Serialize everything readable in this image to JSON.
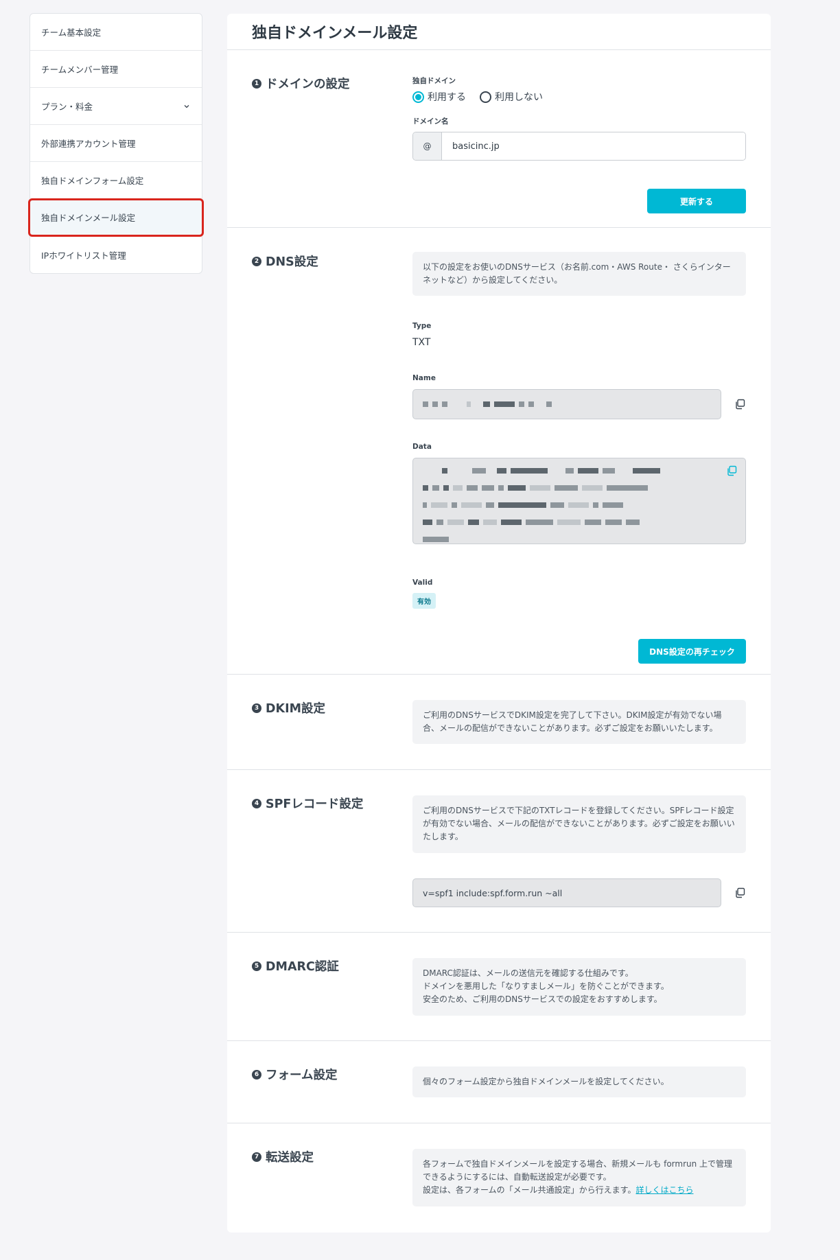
{
  "sidebar": {
    "items": [
      {
        "label": "チーム基本設定"
      },
      {
        "label": "チームメンバー管理"
      },
      {
        "label": "プラン・料金"
      },
      {
        "label": "外部連携アカウント管理"
      },
      {
        "label": "独自ドメインフォーム設定"
      },
      {
        "label": "独自ドメインメール設定"
      },
      {
        "label": "IPホワイトリスト管理"
      }
    ]
  },
  "page": {
    "title": "独自ドメインメール設定"
  },
  "sections": {
    "domain": {
      "label": "ドメインの設定",
      "num": "1",
      "custom_domain_label": "独自ドメイン",
      "radio_use": "利用する",
      "radio_not_use": "利用しない",
      "domain_name_label": "ドメイン名",
      "addon": "@",
      "domain_value": "basicinc.jp",
      "update_button": "更新する"
    },
    "dns": {
      "label": "DNS設定",
      "num": "2",
      "note": "以下の設定をお使いのDNSサービス（お名前.com・AWS Route・ さくらインターネットなど）から設定してください。",
      "type_label": "Type",
      "type_value": "TXT",
      "name_label": "Name",
      "data_label": "Data",
      "valid_label": "Valid",
      "valid_badge": "有効",
      "recheck_button": "DNS設定の再チェック"
    },
    "dkim": {
      "label": "DKIM設定",
      "num": "3",
      "note": "ご利用のDNSサービスでDKIM設定を完了して下さい。DKIM設定が有効でない場合、メールの配信ができないことがあります。必ずご設定をお願いいたします。"
    },
    "spf": {
      "label": "SPFレコード設定",
      "num": "4",
      "note": "ご利用のDNSサービスで下記のTXTレコードを登録してください。SPFレコード設定が有効でない場合、メールの配信ができないことがあります。必ずご設定をお願いいたします。",
      "record": "v=spf1 include:spf.form.run ~all"
    },
    "dmarc": {
      "label": "DMARC認証",
      "num": "5",
      "note_line1": "DMARC認証は、メールの送信元を確認する仕組みです。",
      "note_line2": "ドメインを悪用した「なりすましメール」を防ぐことができます。",
      "note_line3": "安全のため、ご利用のDNSサービスでの設定をおすすめします。"
    },
    "form": {
      "label": "フォーム設定",
      "num": "6",
      "note": "個々のフォーム設定から独自ドメインメールを設定してください。"
    },
    "forward": {
      "label": "転送設定",
      "num": "7",
      "note_line1": "各フォームで独自ドメインメールを設定する場合、新規メールも formrun 上で管理できるようにするには、自動転送設定が必要です。",
      "note_line2": "設定は、各フォームの「メール共通設定」から行えます。",
      "link": "詳しくはこちら"
    }
  },
  "colors": {
    "accent": "#00b8d4",
    "highlight": "#d9251d"
  }
}
